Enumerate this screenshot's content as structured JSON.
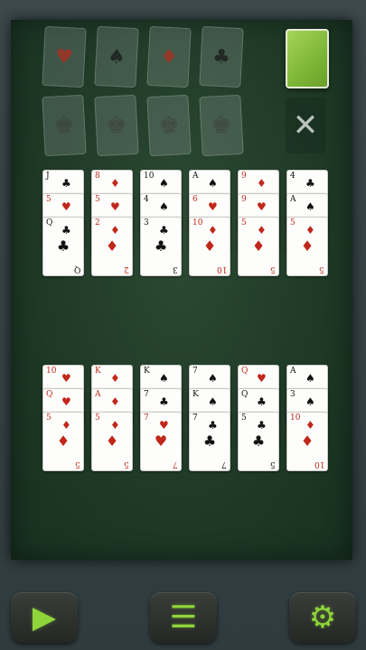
{
  "foundations": {
    "suits": [
      {
        "glyph": "♥",
        "color": "red"
      },
      {
        "glyph": "♠",
        "color": "black"
      },
      {
        "glyph": "♦",
        "color": "red"
      },
      {
        "glyph": "♣",
        "color": "black"
      }
    ],
    "kings": [
      "♚",
      "♚",
      "♚",
      "♚"
    ]
  },
  "waste": {
    "glyph": "✕"
  },
  "top_tableau": [
    [
      {
        "rank": "J",
        "suit": "♣",
        "color": "black"
      },
      {
        "rank": "5",
        "suit": "♥",
        "color": "red"
      },
      {
        "rank": "Q",
        "suit": "♣",
        "color": "black"
      }
    ],
    [
      {
        "rank": "8",
        "suit": "♦",
        "color": "red"
      },
      {
        "rank": "5",
        "suit": "♥",
        "color": "red"
      },
      {
        "rank": "2",
        "suit": "♦",
        "color": "red"
      }
    ],
    [
      {
        "rank": "10",
        "suit": "♠",
        "color": "black"
      },
      {
        "rank": "4",
        "suit": "♠",
        "color": "black"
      },
      {
        "rank": "3",
        "suit": "♣",
        "color": "black"
      }
    ],
    [
      {
        "rank": "A",
        "suit": "♠",
        "color": "black"
      },
      {
        "rank": "6",
        "suit": "♥",
        "color": "red"
      },
      {
        "rank": "10",
        "suit": "♦",
        "color": "red"
      }
    ],
    [
      {
        "rank": "9",
        "suit": "♦",
        "color": "red"
      },
      {
        "rank": "9",
        "suit": "♥",
        "color": "red"
      },
      {
        "rank": "5",
        "suit": "♦",
        "color": "red"
      }
    ],
    [
      {
        "rank": "4",
        "suit": "♣",
        "color": "black"
      },
      {
        "rank": "A",
        "suit": "♠",
        "color": "black"
      },
      {
        "rank": "5",
        "suit": "♦",
        "color": "red"
      }
    ]
  ],
  "bottom_tableau": [
    [
      {
        "rank": "10",
        "suit": "♥",
        "color": "red"
      },
      {
        "rank": "Q",
        "suit": "♥",
        "color": "red"
      },
      {
        "rank": "5",
        "suit": "♦",
        "color": "red"
      }
    ],
    [
      {
        "rank": "K",
        "suit": "♦",
        "color": "red"
      },
      {
        "rank": "A",
        "suit": "♦",
        "color": "red"
      },
      {
        "rank": "5",
        "suit": "♦",
        "color": "red"
      }
    ],
    [
      {
        "rank": "K",
        "suit": "♠",
        "color": "black"
      },
      {
        "rank": "7",
        "suit": "♣",
        "color": "black"
      },
      {
        "rank": "7",
        "suit": "♥",
        "color": "red"
      }
    ],
    [
      {
        "rank": "7",
        "suit": "♠",
        "color": "black"
      },
      {
        "rank": "K",
        "suit": "♠",
        "color": "black"
      },
      {
        "rank": "7",
        "suit": "♣",
        "color": "black"
      }
    ],
    [
      {
        "rank": "Q",
        "suit": "♥",
        "color": "red"
      },
      {
        "rank": "Q",
        "suit": "♣",
        "color": "black"
      },
      {
        "rank": "5",
        "suit": "♣",
        "color": "black"
      }
    ],
    [
      {
        "rank": "A",
        "suit": "♠",
        "color": "black"
      },
      {
        "rank": "3",
        "suit": "♠",
        "color": "black"
      },
      {
        "rank": "10",
        "suit": "♦",
        "color": "red"
      }
    ]
  ],
  "toolbar": [
    {
      "name": "play-button",
      "icon": "play-icon",
      "glyph": "▶"
    },
    {
      "name": "menu-button",
      "icon": "menu-icon",
      "glyph": "☰"
    },
    {
      "name": "settings-button",
      "icon": "gear-icon",
      "glyph": "⚙"
    }
  ],
  "colors": {
    "felt": "#1f3a27",
    "accent": "#8fd43a",
    "red": "#c0271a",
    "black": "#111111"
  }
}
